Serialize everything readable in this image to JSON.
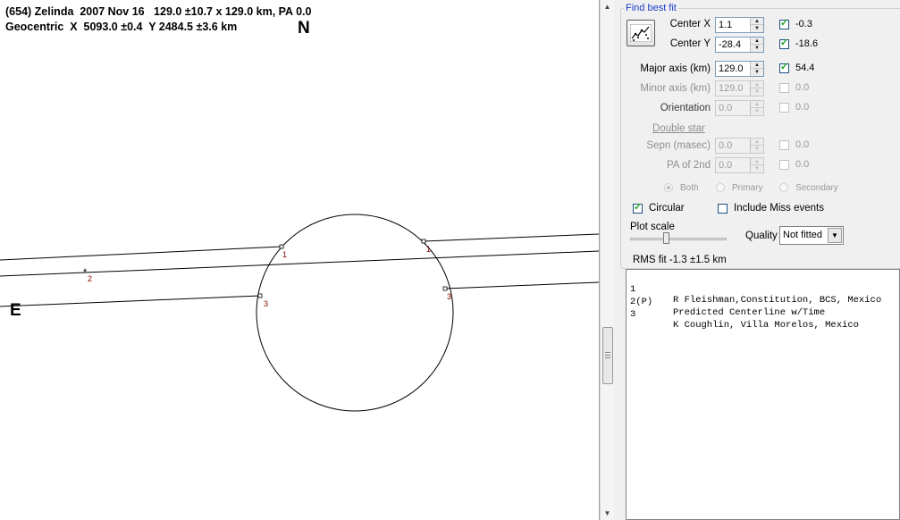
{
  "plot": {
    "header_line1": "(654) Zelinda  2007 Nov 16   129.0 ±10.7 x 129.0 km, PA 0.0",
    "header_line2": "Geocentric  X  5093.0 ±0.4  Y 2484.5 ±3.6 km",
    "north_label": "N",
    "east_label": "E",
    "event_labels": [
      "1",
      "1",
      "2",
      "3",
      "3"
    ]
  },
  "panel": {
    "group_title": "Find best fit",
    "fit_button_icon": "chart-fit-icon",
    "center_x": {
      "label": "Center X",
      "value": "1.1",
      "checked": true,
      "result": "-0.3"
    },
    "center_y": {
      "label": "Center Y",
      "value": "-28.4",
      "checked": true,
      "result": "-18.6"
    },
    "major_axis": {
      "label": "Major axis (km)",
      "value": "129.0",
      "checked": true,
      "result": "54.4"
    },
    "minor_axis": {
      "label": "Minor axis (km)",
      "value": "129.0",
      "checked": false,
      "result": "0.0"
    },
    "orientation": {
      "label": "Orientation",
      "value": "0.0",
      "checked": false,
      "result": "0.0"
    },
    "double_star_link": "Double star",
    "sepn": {
      "label": "Sepn (masec)",
      "value": "0.0",
      "checked": false,
      "result": "0.0"
    },
    "pa_of_2nd": {
      "label": "PA of 2nd",
      "value": "0.0",
      "checked": false,
      "result": "0.0"
    },
    "radio_both": "Both",
    "radio_primary": "Primary",
    "radio_secondary": "Secondary",
    "circular_label": "Circular",
    "circular_checked": true,
    "include_miss_label": "Include Miss events",
    "include_miss_checked": false,
    "plot_scale_label": "Plot scale",
    "quality_label": "Quality",
    "quality_value": "Not fitted",
    "rms_fit": "RMS fit -1.3 ±1.5 km"
  },
  "results": [
    {
      "num": "1",
      "text": "R Fleishman,Constitution, BCS, Mexico"
    },
    {
      "num": "2(P)",
      "text": "Predicted Centerline w/Time"
    },
    {
      "num": "3",
      "text": "K Coughlin, Villa Morelos, Mexico"
    }
  ],
  "colors": {
    "group_title": "#1a3cc8",
    "check": "#21a121",
    "event_label": "#880000"
  }
}
